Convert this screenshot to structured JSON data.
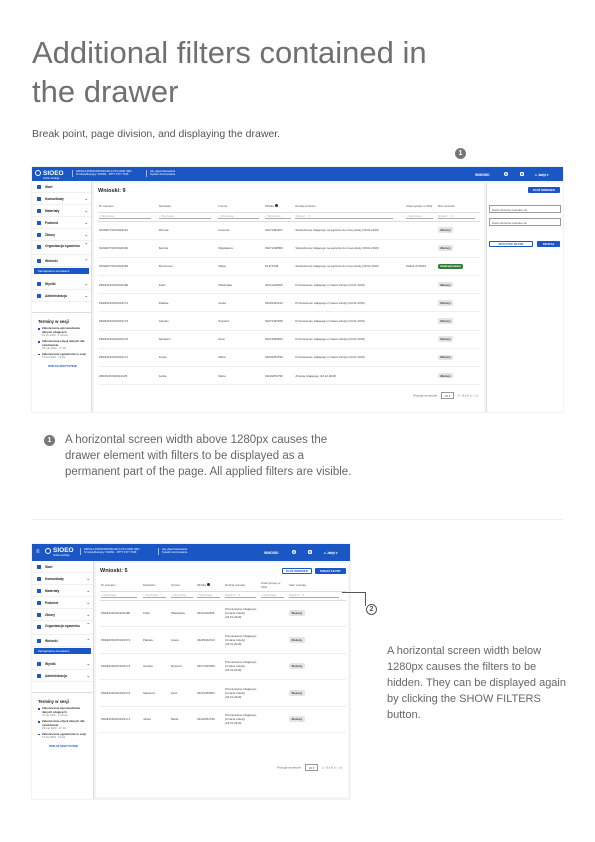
{
  "page": {
    "title": "Additional filters contained in the drawer",
    "subtitle": "Break point, page division, and displaying the drawer.",
    "marker1": "1",
    "marker2": "2",
    "desc1": "A horizontal screen width above 1280px causes the drawer element with filters to be displayed as a permanent part of the page. All applied filters are visible.",
    "desc2": "A horizontal screen width below 1280px causes the filters to be hidden. They can be displayed again by clicking the SHOW FILTERS button."
  },
  "app": {
    "logo": "SIOEO",
    "logo_sub": "Gdzie studiuje",
    "school_line1": "SZKOŁA PODSTAWOWA NR 44 W ŁODZI (NR)",
    "school_line2": "Nr identyfikacyjny: 004391 · PPTT 1577 7918",
    "user_line1": "Ala_Zapotrzebowania",
    "user_line2": "Sysadm koordynatora",
    "nav_link": "WNIOSKI",
    "help_icon": "?",
    "apps_icon": "#",
    "user": "Jadyt",
    "sidebar": [
      {
        "label": "Start",
        "icon": "home-icon"
      },
      {
        "label": "Komunikaty",
        "icon": "message-icon"
      },
      {
        "label": "Materiały",
        "icon": "folder-icon"
      },
      {
        "label": "Podmiot",
        "icon": "building-icon"
      },
      {
        "label": "Zbiory",
        "icon": "stack-icon"
      },
      {
        "label": "Organizacja egzaminu",
        "icon": "calendar-icon"
      },
      {
        "label": "Wnioski",
        "icon": "document-icon"
      },
      {
        "label": "Wyniki",
        "icon": "chart-icon"
      },
      {
        "label": "Administracja",
        "icon": "gear-icon"
      }
    ],
    "sidebar_active": "Zarządzanie wnioskami",
    "terms_title": "Terminy w sesji",
    "terms": [
      {
        "title": "Zakończenie wprowadzania danych zdających",
        "date": "31 sty 2019 · 1 minuta"
      },
      {
        "title": "Zakończenie edycji danych dla zamówienia",
        "date": "29 mar 2019 · 17 dni"
      },
      {
        "title": "Zakończenie egzaminów w sesji",
        "date": "17 kwi 2019 · 72 dni"
      }
    ],
    "show_all": "POKAŻ WSZYSTKIE"
  },
  "list": {
    "heading": "Wnioski: 9",
    "heading_small": "Wnioski: 5",
    "new_button": "ZŁÓŻ WNIOSEK",
    "show_filters_button": "POKAŻ FILTRY",
    "columns": [
      "Nr wniosku",
      "Nazwisko",
      "Imiona",
      "PESEL",
      "Rodzaj wniosku",
      "Znak sprawy w OKE",
      "Stan wniosku"
    ],
    "filter_placeholder": "Wyszukaj...",
    "filter_select": "Wybierz...",
    "rows": [
      {
        "nr": "SK4DR/7/0/2019/2191",
        "nazwisko": "Wronek",
        "imie": "Ireneusz",
        "pesel": "03271466407",
        "rodzaj": "Stwierdzenie zdającego na egzamin do innej szkoły (29.01.2019)",
        "znak": "",
        "stan": "Złożony",
        "green": false
      },
      {
        "nr": "SK4DR/7/0/2019/2190",
        "nazwisko": "Kaczek",
        "imie": "Magdalena",
        "pesel": "03271228563",
        "rodzaj": "Stwierdzenie zdającego na egzamin do innej szkoły (29.01.2019)",
        "znak": "",
        "stan": "Złożony",
        "green": false
      },
      {
        "nr": "SK4DR/7/0/2019/2189",
        "nazwisko": "Rozmumer",
        "imie": "Marta",
        "pesel": "PL374158",
        "rodzaj": "Stwierdzenie zdającego na egzamin do innej szkoły (29.01.2019)",
        "znak": "PZ421-07/2019",
        "stan": "Zaakceptowany",
        "green": true
      },
      {
        "nr": "PRZEN/3/0/2019/2180",
        "nazwisko": "Kratz",
        "imie": "Władysław",
        "pesel": "03211442656",
        "rodzaj": "Przeniesienie zdającego (zmiana szkoły) (24.01.2019)",
        "znak": "",
        "stan": "Złożony",
        "green": false
      },
      {
        "nr": "PRZEN/3/0/2019/2174",
        "nazwisko": "Pałetka",
        "imie": "Aneta",
        "pesel": "03225442313",
        "rodzaj": "Przeniesienie zdającego (zmiana szkoły) (23.01.2019)",
        "znak": "",
        "stan": "Złożony",
        "green": false
      },
      {
        "nr": "PRZEN/3/0/2019/2173",
        "nazwisko": "Gamiko",
        "imie": "Ryszard",
        "pesel": "03271345258",
        "rodzaj": "Przeniesienie zdającego (zmiana szkoły) (23.01.2019)",
        "znak": "",
        "stan": "Złożony",
        "green": false
      },
      {
        "nr": "PRZEN/3/0/2019/2172",
        "nazwisko": "Sankiemi",
        "imie": "Zeus",
        "pesel": "03213456663",
        "rodzaj": "Przeniesienie zdającego (zmiana szkoły) (23.01.2019)",
        "znak": "",
        "stan": "Złożony",
        "green": false
      },
      {
        "nr": "PRZEN/3/0/2019/2171",
        "nazwisko": "Jantia",
        "imie": "Maria",
        "pesel": "03222254796",
        "rodzaj": "Przeniesienie zdającego (zmiana szkoły) (23.01.2019)",
        "znak": "",
        "stan": "Złożony",
        "green": false
      },
      {
        "nr": "ZMIAN/3/0/2019/2125",
        "nazwisko": "Jantia",
        "imie": "Maria",
        "pesel": "03222254796",
        "rodzaj": "Zmiana zdającego (16.12.2018)",
        "znak": "",
        "stan": "Złożony",
        "green": false
      }
    ],
    "pager_label": "Pozycje na stronie",
    "pager_size": "20",
    "pager_range_large": "1 - 9 z 9",
    "pager_range_small": "1 - 5 z 5"
  },
  "drawer": {
    "date_from": "Data złożenia wniosku od",
    "date_to": "Data złożenia wniosku do",
    "clear": "WYCZYŚĆ FILTRY",
    "apply": "SZUKAJ"
  }
}
